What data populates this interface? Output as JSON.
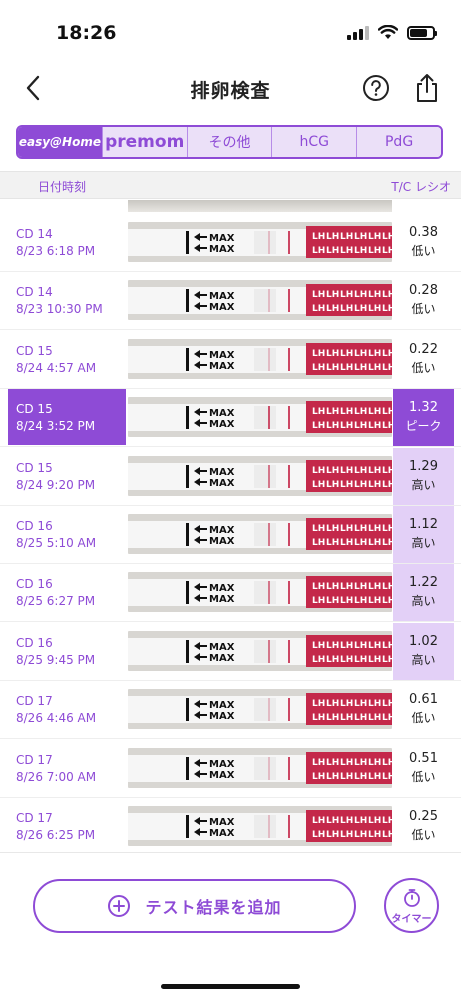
{
  "status_bar": {
    "time": "18:26"
  },
  "nav": {
    "title": "排卵検査"
  },
  "brand_tabs": [
    {
      "label": "easy@Home",
      "active": true
    },
    {
      "label": "premom",
      "active": false
    },
    {
      "label": "その他",
      "active": false
    },
    {
      "label": "hCG",
      "active": false
    },
    {
      "label": "PdG",
      "active": false
    }
  ],
  "columns": {
    "date": "日付時刻",
    "ratio": "T/C レシオ"
  },
  "rows": [
    {
      "cd": "CD 14",
      "datetime": "8/23 6:18 PM",
      "ratio": "0.38",
      "level": "低い",
      "status": "low"
    },
    {
      "cd": "CD 14",
      "datetime": "8/23 10:30 PM",
      "ratio": "0.28",
      "level": "低い",
      "status": "low"
    },
    {
      "cd": "CD 15",
      "datetime": "8/24 4:57 AM",
      "ratio": "0.22",
      "level": "低い",
      "status": "low"
    },
    {
      "cd": "CD 15",
      "datetime": "8/24 3:52 PM",
      "ratio": "1.32",
      "level": "ピーク",
      "status": "peak"
    },
    {
      "cd": "CD 15",
      "datetime": "8/24 9:20 PM",
      "ratio": "1.29",
      "level": "高い",
      "status": "high"
    },
    {
      "cd": "CD 16",
      "datetime": "8/25 5:10 AM",
      "ratio": "1.12",
      "level": "高い",
      "status": "high"
    },
    {
      "cd": "CD 16",
      "datetime": "8/25 6:27 PM",
      "ratio": "1.22",
      "level": "高い",
      "status": "high"
    },
    {
      "cd": "CD 16",
      "datetime": "8/25 9:45 PM",
      "ratio": "1.02",
      "level": "高い",
      "status": "high"
    },
    {
      "cd": "CD 17",
      "datetime": "8/26 4:46 AM",
      "ratio": "0.61",
      "level": "低い",
      "status": "low"
    },
    {
      "cd": "CD 17",
      "datetime": "8/26 7:00 AM",
      "ratio": "0.51",
      "level": "低い",
      "status": "low"
    },
    {
      "cd": "CD 17",
      "datetime": "8/26 6:25 PM",
      "ratio": "0.25",
      "level": "低い",
      "status": "low"
    }
  ],
  "strip_text": {
    "max": "MAX",
    "lh": "LH"
  },
  "add_button": {
    "label": "テスト結果を追加"
  },
  "timer_button": {
    "label": "タイマー"
  },
  "colors": {
    "accent": "#8e4bd6",
    "high_bg": "#e3d0f7",
    "strip_red": "#c4284a"
  }
}
